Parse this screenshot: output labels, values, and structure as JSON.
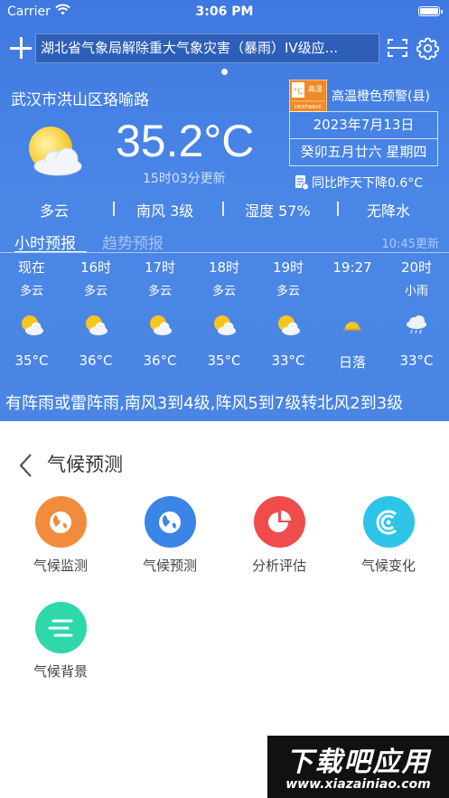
{
  "status_bar": {
    "carrier": "Carrier",
    "time": "3:06 PM"
  },
  "header": {
    "alert_ticker": "湖北省气象局解除重大气象灾害（暴雨）IV级应..."
  },
  "current": {
    "location": "武汉市洪山区珞喻路",
    "temperature": "35.2°C",
    "update_time": "15时03分更新",
    "warning_badge_top": "高温",
    "warning_badge_sub": "HEATWAVE",
    "warning_badge_color": "#f08a24",
    "warning_text": "高温橙色预警(县)",
    "date": "2023年7月13日",
    "lunar": "癸卯五月廿六 星期四",
    "compare": "同比昨天下降0.6°C",
    "conditions": {
      "weather": "多云",
      "wind": "南风 3级",
      "humidity": "湿度 57%",
      "precip": "无降水"
    }
  },
  "tabs": {
    "hourly": "小时预报",
    "trend": "趋势预报",
    "updated": "10:45更新"
  },
  "hourly": [
    {
      "time": "现在",
      "cond": "多云",
      "icon": "partly-cloudy-icon",
      "temp": "35°C"
    },
    {
      "time": "16时",
      "cond": "多云",
      "icon": "partly-cloudy-icon",
      "temp": "36°C"
    },
    {
      "time": "17时",
      "cond": "多云",
      "icon": "partly-cloudy-icon",
      "temp": "36°C"
    },
    {
      "time": "18时",
      "cond": "多云",
      "icon": "partly-cloudy-icon",
      "temp": "35°C"
    },
    {
      "time": "19时",
      "cond": "多云",
      "icon": "partly-cloudy-icon",
      "temp": "33°C"
    },
    {
      "time": "19:27",
      "cond": "",
      "icon": "sunset-icon",
      "temp": "日落"
    },
    {
      "time": "20时",
      "cond": "小雨",
      "icon": "light-rain-icon",
      "temp": "33°C"
    }
  ],
  "forecast_text": "有阵雨或雷阵雨,南风3到4级,阵风5到7级转北风2到3级",
  "panel": {
    "title": "气候预测",
    "tiles": [
      {
        "label": "气候监测",
        "icon": "globe-icon",
        "color": "#f08c3c"
      },
      {
        "label": "气候预测",
        "icon": "globe-icon",
        "color": "#3a85e6"
      },
      {
        "label": "分析评估",
        "icon": "pie-chart-icon",
        "color": "#f04c4c"
      },
      {
        "label": "气候变化",
        "icon": "climate-change-icon",
        "color": "#2ec4e8"
      },
      {
        "label": "气候背景",
        "icon": "wind-lines-icon",
        "color": "#2ed8a8"
      }
    ]
  },
  "watermark": {
    "top": "下载吧应用",
    "bottom": "www.xiazainiao.com"
  }
}
